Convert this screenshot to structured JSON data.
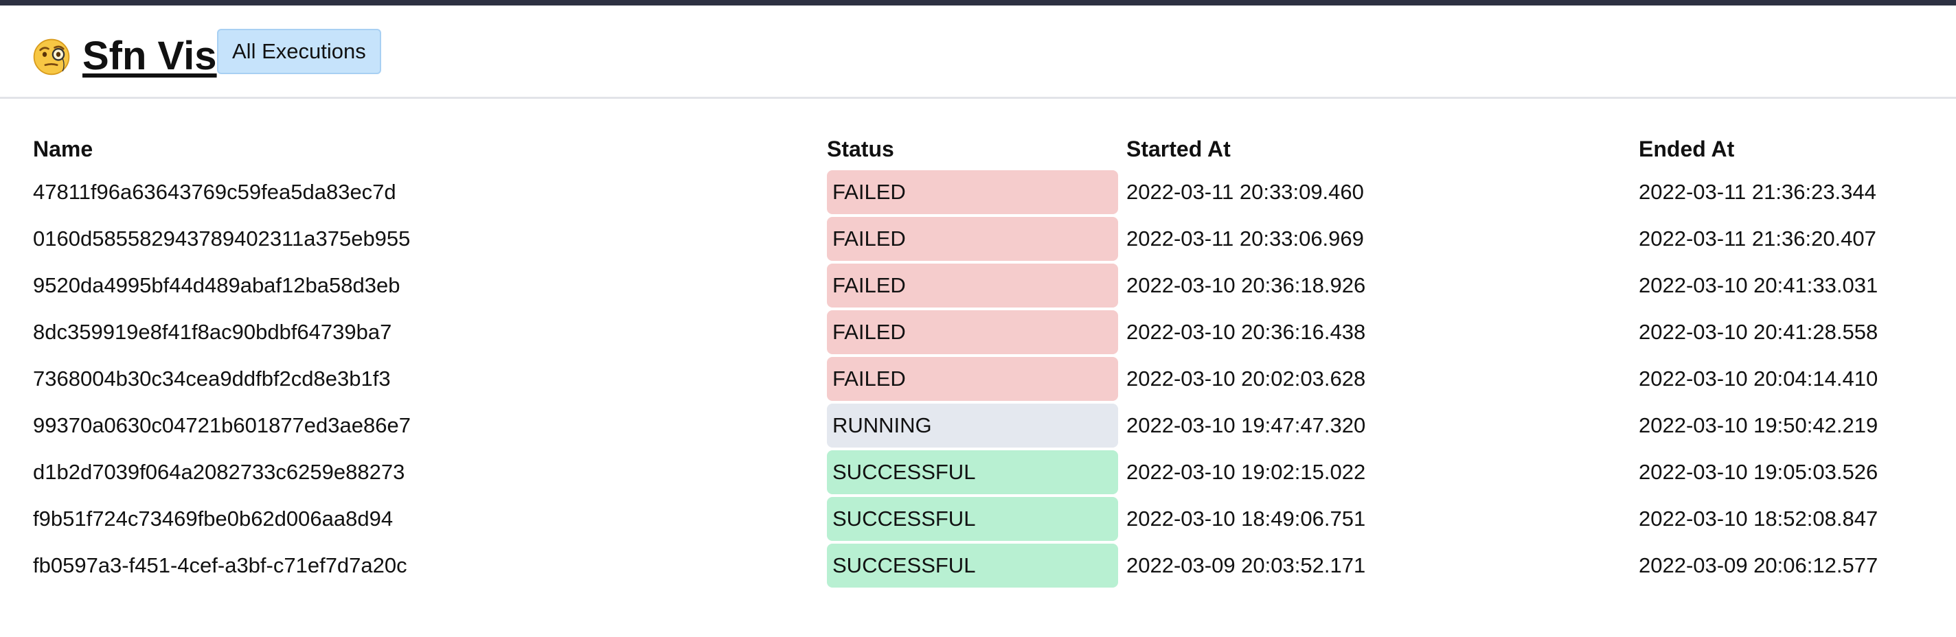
{
  "header": {
    "title": "Sfn Vis",
    "emoji_icon": "face-with-monocle-icon",
    "nav_button_label": "All Executions"
  },
  "table": {
    "columns": [
      "Name",
      "Status",
      "Started At",
      "Ended At"
    ],
    "rows": [
      {
        "name": "47811f96a63643769c59fea5da83ec7d",
        "status": "FAILED",
        "started_at": "2022-03-11 20:33:09.460",
        "ended_at": "2022-03-11 21:36:23.344"
      },
      {
        "name": "0160d585582943789402311a375eb955",
        "status": "FAILED",
        "started_at": "2022-03-11 20:33:06.969",
        "ended_at": "2022-03-11 21:36:20.407"
      },
      {
        "name": "9520da4995bf44d489abaf12ba58d3eb",
        "status": "FAILED",
        "started_at": "2022-03-10 20:36:18.926",
        "ended_at": "2022-03-10 20:41:33.031"
      },
      {
        "name": "8dc359919e8f41f8ac90bdbf64739ba7",
        "status": "FAILED",
        "started_at": "2022-03-10 20:36:16.438",
        "ended_at": "2022-03-10 20:41:28.558"
      },
      {
        "name": "7368004b30c34cea9ddfbf2cd8e3b1f3",
        "status": "FAILED",
        "started_at": "2022-03-10 20:02:03.628",
        "ended_at": "2022-03-10 20:04:14.410"
      },
      {
        "name": "99370a0630c04721b601877ed3ae86e7",
        "status": "RUNNING",
        "started_at": "2022-03-10 19:47:47.320",
        "ended_at": "2022-03-10 19:50:42.219"
      },
      {
        "name": "d1b2d7039f064a2082733c6259e88273",
        "status": "SUCCESSFUL",
        "started_at": "2022-03-10 19:02:15.022",
        "ended_at": "2022-03-10 19:05:03.526"
      },
      {
        "name": "f9b51f724c73469fbe0b62d006aa8d94",
        "status": "SUCCESSFUL",
        "started_at": "2022-03-10 18:49:06.751",
        "ended_at": "2022-03-10 18:52:08.847"
      },
      {
        "name": "fb0597a3-f451-4cef-a3bf-c71ef7d7a20c",
        "status": "SUCCESSFUL",
        "started_at": "2022-03-09 20:03:52.171",
        "ended_at": "2022-03-09 20:06:12.577"
      }
    ]
  },
  "colors": {
    "top_strip": "#2d3142",
    "nav_button_bg": "#c6e3fb",
    "failed": "#f5cccc",
    "running": "#e4e8ef",
    "successful": "#b8f0d2"
  }
}
